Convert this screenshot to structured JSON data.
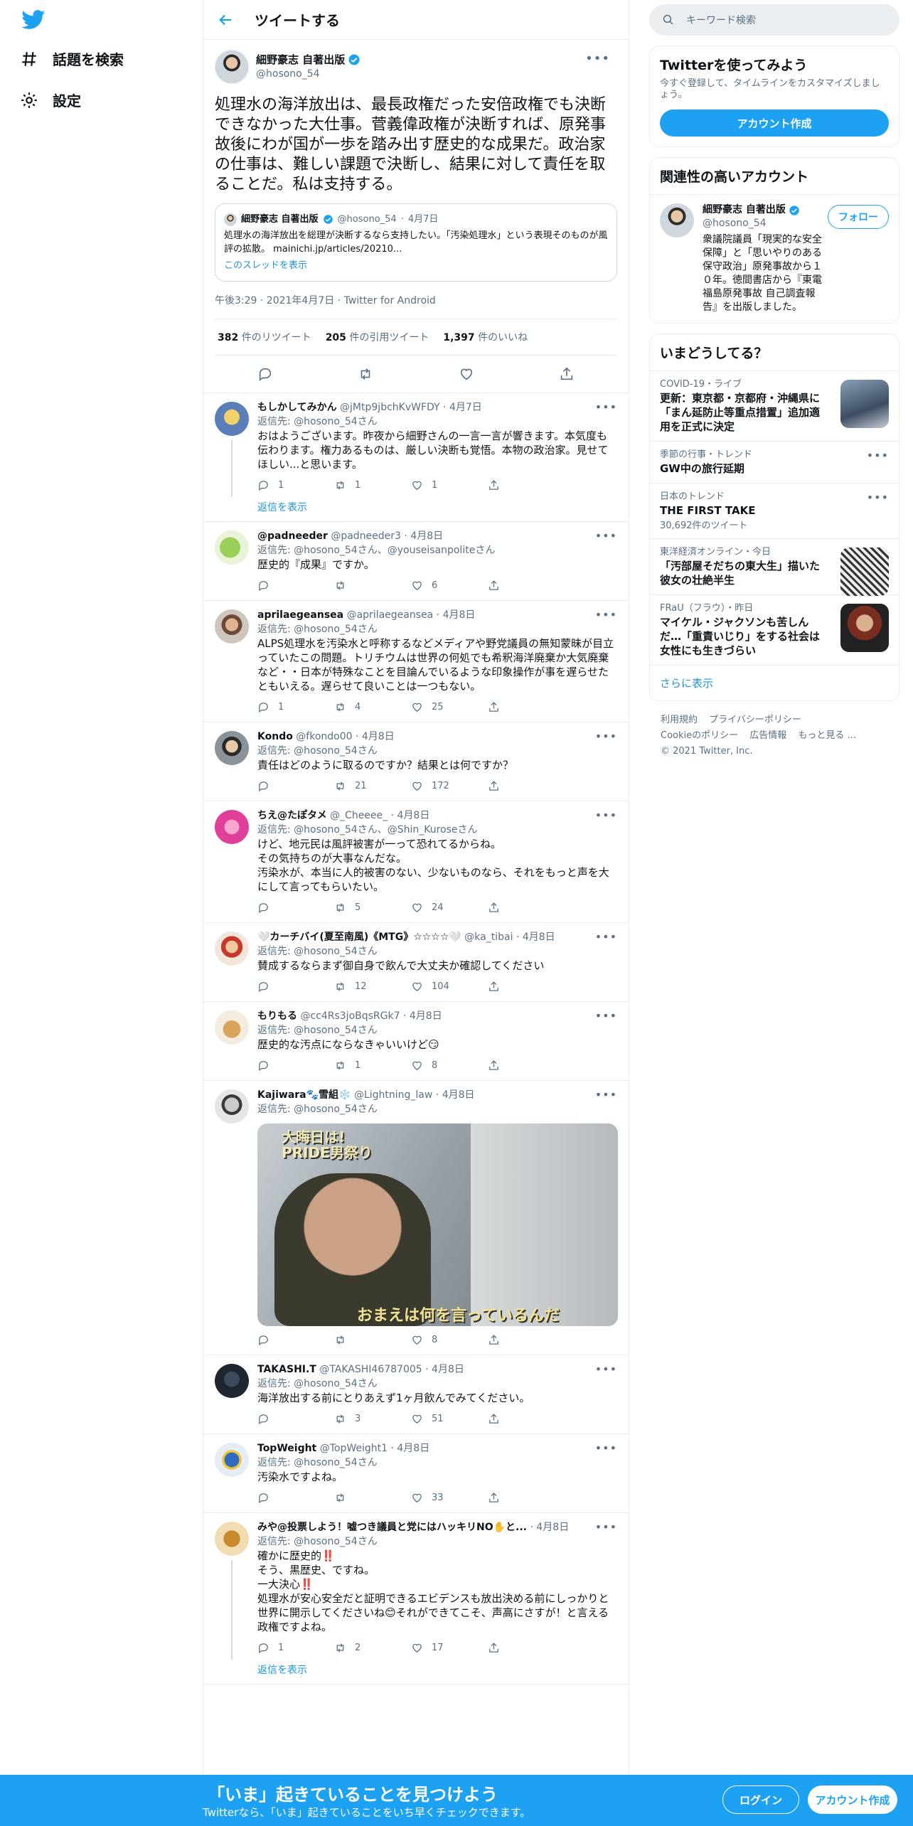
{
  "nav": {
    "explore_label": "話題を検索",
    "settings_label": "設定"
  },
  "header": {
    "title": "ツイートする"
  },
  "main_tweet": {
    "name": "細野豪志 自著出版",
    "handle": "@hosono_54",
    "text": "処理水の海洋放出は、最長政権だった安倍政権でも決断できなかった大仕事。菅義偉政権が決断すれば、原発事故後にわが国が一歩を踏み出す歴史的な成果だ。政治家の仕事は、難しい課題で決断し、結果に対して責任を取ることだ。私は支持する。",
    "quote": {
      "name": "細野豪志 自著出版",
      "handle": "@hosono_54",
      "date": "4月7日",
      "text": "処理水の海洋放出を総理が決断するなら支持したい。「汚染処理水」という表現そのものが風評の拡散。 mainichi.jp/articles/20210...",
      "show_thread": "このスレッドを表示"
    },
    "meta": "午後3:29 · 2021年4月7日 · Twitter for Android",
    "retweets": "382",
    "retweets_label": "件のリツイート",
    "quotes": "205",
    "quotes_label": "件の引用ツイート",
    "likes": "1,397",
    "likes_label": "件のいいね"
  },
  "replies": [
    {
      "name": "もしかしてみかん",
      "handle": "@jMtp9jbchKvWFDY",
      "date": "4月7日",
      "reply_to": "返信先: @hosono_54さん",
      "text": "おはようございます。昨夜から細野さんの一言一言が響きます。本気度も伝わります。権力あるものは、厳しい決断も覚悟。本物の政治家。見せてほしい...と思います。",
      "replies": "1",
      "retweets": "1",
      "likes": "1",
      "show_thread": "返信を表示"
    },
    {
      "name": "@padneeder",
      "handle": "@padneeder3",
      "date": "4月8日",
      "reply_to": "返信先: @hosono_54さん、@youseisanpoliteさん",
      "text": "歴史的『成果』ですか。",
      "replies": "",
      "retweets": "",
      "likes": "6"
    },
    {
      "name": "aprilaegeansea",
      "handle": "@aprilaegeansea",
      "date": "4月8日",
      "reply_to": "返信先: @hosono_54さん",
      "text": "ALPS処理水を汚染水と呼称するなどメディアや野党議員の無知蒙昧が目立っていたこの問題。トリチウムは世界の何処でも希釈海洋廃棄か大気廃棄など・・日本が特殊なことを目論んでいるような印象操作が事を遅らせたともいえる。遅らせて良いことは一つもない。",
      "replies": "1",
      "retweets": "4",
      "likes": "25"
    },
    {
      "name": "Kondo",
      "handle": "@fkondo00",
      "date": "4月8日",
      "reply_to": "返信先: @hosono_54さん",
      "text": "責任はどのように取るのですか？結果とは何ですか？",
      "replies": "",
      "retweets": "21",
      "likes": "172"
    },
    {
      "name": "ちえ@たぽタメ",
      "handle": "@_Cheeee_",
      "date": "4月8日",
      "reply_to": "返信先: @hosono_54さん、@Shin_Kuroseさん",
      "text": "けど、地元民は風評被害が一って恐れてるからね。\nその気持ちのが大事なんだな。\n汚染水が、本当に人的被害のない、少ないものなら、それをもっと声を大にして言ってもらいたい。",
      "replies": "",
      "retweets": "5",
      "likes": "24"
    },
    {
      "name": "🤍カーチバイ(夏至南風)《MTG》☆☆☆☆🤍",
      "handle": "@ka_tibai",
      "date": "4月8日",
      "reply_to": "返信先: @hosono_54さん",
      "text": "賛成するならまず御自身で飲んで大丈夫か確認してください",
      "replies": "",
      "retweets": "12",
      "likes": "104"
    },
    {
      "name": "もりもる",
      "handle": "@cc4Rs3joBqsRGk7",
      "date": "4月8日",
      "reply_to": "返信先: @hosono_54さん",
      "text": "歴史的な汚点にならなきゃいいけど😏",
      "replies": "",
      "retweets": "1",
      "likes": "8"
    },
    {
      "name": "Kajiwara🐾雪組❄️",
      "handle": "@Lightning_law",
      "date": "4月8日",
      "reply_to": "返信先: @hosono_54さん",
      "text": "",
      "media_caption_top": "大晦日は!\nPRIDE男祭り",
      "media_caption_bottom": "おまえは何を言っているんだ",
      "replies": "",
      "retweets": "",
      "likes": "8"
    },
    {
      "name": "TAKASHI.T",
      "handle": "@TAKASHI46787005",
      "date": "4月8日",
      "reply_to": "返信先: @hosono_54さん",
      "text": "海洋放出する前にとりあえず1ヶ月飲んでみてください。",
      "replies": "",
      "retweets": "3",
      "likes": "51"
    },
    {
      "name": "TopWeight",
      "handle": "@TopWeight1",
      "date": "4月8日",
      "reply_to": "返信先: @hosono_54さん",
      "text": "汚染水ですよね。",
      "replies": "",
      "retweets": "",
      "likes": "33"
    },
    {
      "name": "みや@投票しよう！嘘つき議員と党にはハッキリNO✋と...",
      "handle": "",
      "date": "4月8日",
      "reply_to": "返信先: @hosono_54さん",
      "text": "確かに歴史的‼️\nそう、黒歴史、ですね。\n一大決心‼️\n処理水が安心安全だと証明できるエビデンスも放出決める前にしっかりと世界に開示してくださいね😊それができてこそ、声高にさすが！と言える政権ですよね。",
      "replies": "1",
      "retweets": "2",
      "likes": "17",
      "show_thread": "返信を表示"
    }
  ],
  "right": {
    "search_placeholder": "キーワード検索",
    "signup": {
      "title": "Twitterを使ってみよう",
      "subtitle": "今すぐ登録して、タイムラインをカスタマイズしましょう。",
      "button": "アカウント作成"
    },
    "related": {
      "title": "関連性の高いアカウント",
      "name": "細野豪志 自著出版",
      "handle": "@hosono_54",
      "bio": "衆議院議員「現実的な安全保障」と「思いやりのある保守政治」原発事故から１０年。徳間書店から『東電福島原発事故 自己調査報告』を出版しました。",
      "follow": "フォロー"
    },
    "trends": {
      "title": "いまどうしてる？",
      "items": [
        {
          "context": "COVID-19・ライブ",
          "title": "更新：東京都・京都府・沖縄県に「まん延防止等重点措置」追加適用を正式に決定",
          "count": ""
        },
        {
          "context": "季節の行事・トレンド",
          "title": "GW中の旅行延期",
          "count": ""
        },
        {
          "context": "日本のトレンド",
          "title": "THE FIRST TAKE",
          "count": "30,692件のツイート"
        },
        {
          "context": "東洋経済オンライン・今日",
          "title": "「汚部屋そだちの東大生」描いた彼女の壮絶半生",
          "count": ""
        },
        {
          "context": "FRaU（フラウ）・昨日",
          "title": "マイケル・ジャクソンも苦しんだ…「重責いじり」をする社会は女性にも生きづらい",
          "count": ""
        }
      ],
      "show_more": "さらに表示"
    },
    "footer": {
      "links": [
        "利用規約",
        "プライバシーポリシー",
        "Cookieのポリシー",
        "広告情報",
        "もっと見る ..."
      ],
      "copyright": "© 2021 Twitter, Inc."
    }
  },
  "bottom_bar": {
    "title": "「いま」起きていることを見つけよう",
    "subtitle": "Twitterなら、「いま」起きていることをいち早くチェックできます。",
    "login": "ログイン",
    "signup": "アカウント作成"
  },
  "colors": {
    "accent": "#1da1f2",
    "link": "#1b95e0",
    "muted": "#5b7083",
    "border": "#ebeef0"
  }
}
